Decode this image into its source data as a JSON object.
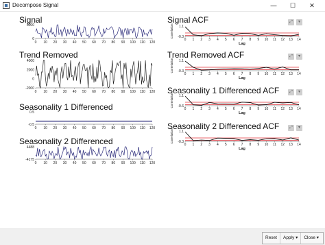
{
  "window": {
    "title": "Decompose Signal",
    "controls": [
      "—",
      "☐",
      "✕"
    ]
  },
  "panels": [
    {
      "title": "Signal",
      "yticks": [
        "6000",
        "0"
      ],
      "xticks": [
        "0",
        "10",
        "20",
        "30",
        "40",
        "50",
        "60",
        "70",
        "80",
        "90",
        "100",
        "110",
        "120"
      ],
      "color": "#2b2b7a"
    },
    {
      "title": "Trend Removed",
      "yticks": [
        "4000",
        "2000",
        "0",
        "-2000"
      ],
      "xticks": [
        "0",
        "10",
        "20",
        "30",
        "40",
        "50",
        "60",
        "70",
        "80",
        "90",
        "100",
        "110",
        "120"
      ],
      "color": "#222222"
    },
    {
      "title": "Seasonality 1 Differenced",
      "yticks": [
        "0.5",
        "-0.5"
      ],
      "xticks": [
        "0",
        "10",
        "20",
        "30",
        "40",
        "50",
        "60",
        "70",
        "80",
        "90",
        "100",
        "110",
        "120"
      ],
      "color": "#2b2b7a"
    },
    {
      "title": "Seasonality 2 Differenced",
      "yticks": [
        "4488",
        "-4175"
      ],
      "xticks": [
        "0",
        "10",
        "20",
        "30",
        "40",
        "50",
        "60",
        "70",
        "80",
        "90",
        "100",
        "110",
        "120"
      ],
      "color": "#2b2b7a"
    }
  ],
  "acf_panels": [
    {
      "title": "Signal ACF",
      "yticks": [
        "1.1",
        "-0.3"
      ],
      "ylabel": "Correlation"
    },
    {
      "title": "Trend Removed ACF",
      "yticks": [
        "1.1",
        "-0.3"
      ],
      "ylabel": "Correlation"
    },
    {
      "title": "Seasonality 1 Differenced ACF",
      "yticks": [
        "1.1",
        "-0.6"
      ],
      "ylabel": "Correlation"
    },
    {
      "title": "Seasonality 2 Differenced ACF",
      "yticks": [
        "1.1",
        "-0.3"
      ],
      "ylabel": "Correlation"
    }
  ],
  "acf_xticks": [
    "0",
    "1",
    "2",
    "3",
    "4",
    "5",
    "6",
    "7",
    "8",
    "9",
    "10",
    "11",
    "12",
    "13",
    "14"
  ],
  "acf_xlabel": "Lag",
  "acf_icons": {
    "expand": "expand-icon",
    "menu": "dropdown-icon"
  },
  "colors": {
    "acf_line": "#111111",
    "conf_band": "#e0303a"
  },
  "footer": {
    "reset_label": "Reset",
    "apply_label": "Apply",
    "apply_arrow": "▾",
    "close_label": "Close",
    "close_arrow": "▾"
  }
}
